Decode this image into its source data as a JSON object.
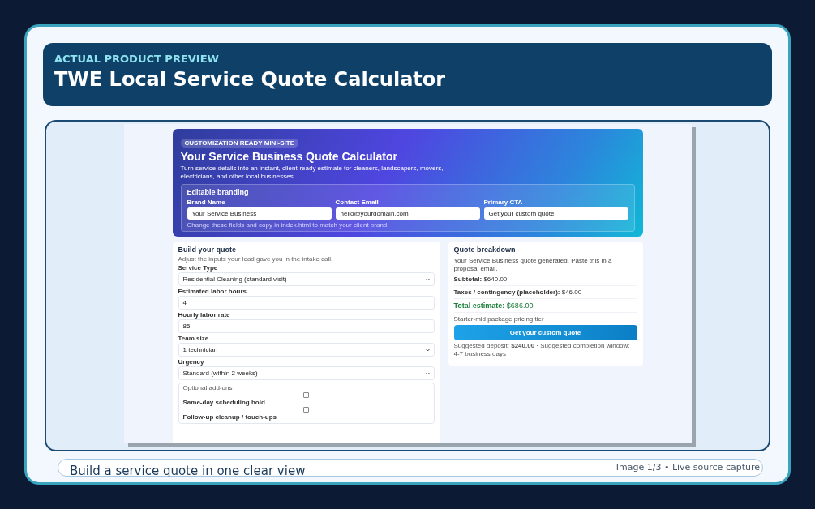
{
  "header": {
    "eyebrow": "ACTUAL PRODUCT PREVIEW",
    "title": "TWE Local Service Quote Calculator"
  },
  "preview": {
    "hero": {
      "badge": "CUSTOMIZATION READY MINI-SITE",
      "title": "Your Service Business Quote Calculator",
      "description": "Turn service details into an instant, client-ready estimate for cleaners, landscapers, movers, electricians, and other local businesses.",
      "branding": {
        "title": "Editable branding",
        "fields": [
          {
            "label": "Brand Name",
            "value": "Your Service Business"
          },
          {
            "label": "Contact Email",
            "value": "hello@yourdomain.com"
          },
          {
            "label": "Primary CTA",
            "value": "Get your custom quote"
          }
        ],
        "hint": "Change these fields and copy in index.html to match your client brand."
      }
    },
    "form": {
      "title": "Build your quote",
      "description": "Adjust the inputs your lead gave you in the intake call.",
      "fields": [
        {
          "kind": "select",
          "label": "Service Type",
          "value": "Residential Cleaning (standard visit)"
        },
        {
          "kind": "input",
          "label": "Estimated labor hours",
          "value": "4"
        },
        {
          "kind": "input",
          "label": "Hourly labor rate",
          "value": "85"
        },
        {
          "kind": "select",
          "label": "Team size",
          "value": "1 technician"
        },
        {
          "kind": "select",
          "label": "Urgency",
          "value": "Standard (within 2 weeks)"
        }
      ],
      "addons": {
        "legend": "Optional add-ons",
        "items": [
          {
            "label": "Same-day scheduling hold",
            "checked": false
          },
          {
            "label": "Follow-up cleanup / touch-ups",
            "checked": false
          }
        ]
      }
    },
    "breakdown": {
      "title": "Quote breakdown",
      "intro": "Your Service Business quote generated. Paste this in a proposal email.",
      "lines": [
        {
          "kind": "line",
          "text": "**Subtotal:** $640.00"
        },
        {
          "kind": "line",
          "text": "**Taxes / contingency (placeholder):** $46.00"
        },
        {
          "kind": "total",
          "text": "**Total estimate:** $686.00"
        }
      ],
      "tier": "Starter-mid package pricing tier",
      "button": "Get your custom quote",
      "note": "Suggested deposit: **$240.00** · Suggested completion window: 4-7 business days"
    }
  },
  "footer": {
    "caption": "Build a service quote in one clear view",
    "counter": "Image 1/3 • Live source capture"
  }
}
